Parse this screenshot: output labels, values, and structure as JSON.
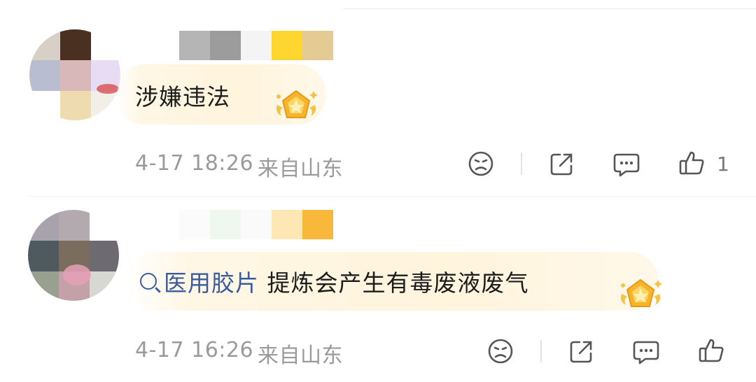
{
  "comments": [
    {
      "text": "涉嫌违法",
      "time": "4-17 18:26",
      "location": "来自山东",
      "like_count": "1",
      "avatar_icon": "pixelated-avatar-icon",
      "badge_icon": "gold-badge-icon"
    },
    {
      "link_text": "医用胶片",
      "text": "提炼会产生有毒废液废气",
      "time": "4-17 16:26",
      "location": "来自山东",
      "like_count": "",
      "avatar_icon": "pixelated-avatar-icon",
      "badge_icon": "gold-badge-icon"
    }
  ],
  "action_icons": [
    "dislike-face-icon",
    "share-icon",
    "reply-icon",
    "like-thumb-icon"
  ],
  "colors": {
    "link": "#3a5b9c",
    "meta": "#9a9a9a",
    "badge_gold": "#f5b531",
    "bubble": "#fff4dc"
  }
}
